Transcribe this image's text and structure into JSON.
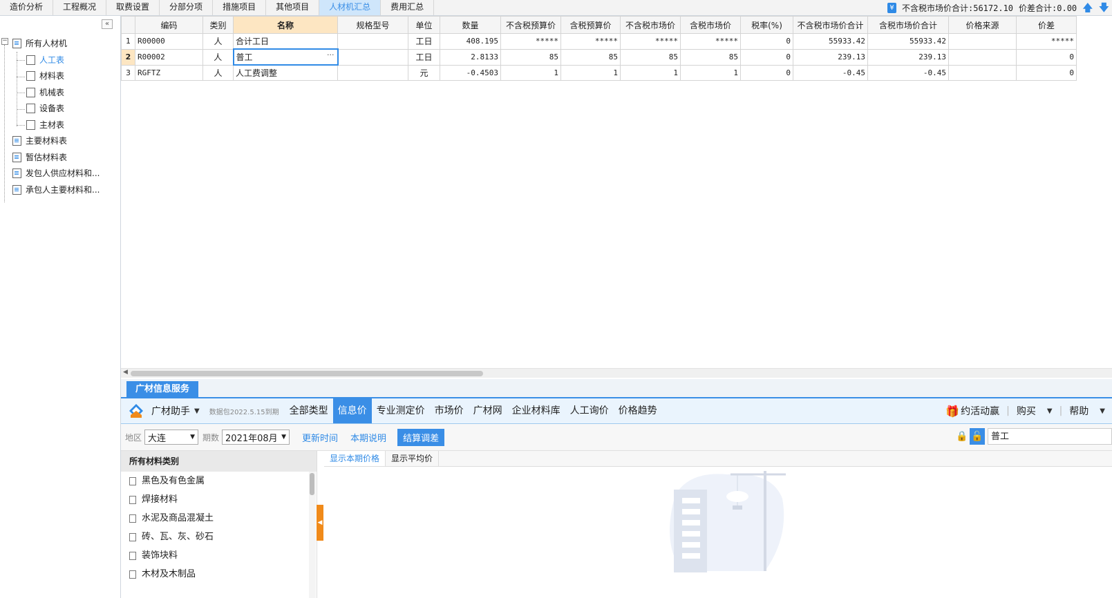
{
  "tabs": [
    {
      "label": "造价分析",
      "active": false
    },
    {
      "label": "工程概况",
      "active": false
    },
    {
      "label": "取费设置",
      "active": false
    },
    {
      "label": "分部分项",
      "active": false
    },
    {
      "label": "措施项目",
      "active": false
    },
    {
      "label": "其他项目",
      "active": false
    },
    {
      "label": "人材机汇总",
      "active": true
    },
    {
      "label": "费用汇总",
      "active": false
    }
  ],
  "summary": {
    "market_total": "不含税市场价合计:56172.10",
    "diff_total": "价差合计:0.00"
  },
  "tree": {
    "root": "所有人材机",
    "children": [
      "人工表",
      "材料表",
      "机械表",
      "设备表",
      "主材表"
    ],
    "selected": "人工表",
    "others": [
      "主要材料表",
      "暂估材料表",
      "发包人供应材料和...",
      "承包人主要材料和..."
    ]
  },
  "grid": {
    "columns": [
      "编码",
      "类别",
      "名称",
      "规格型号",
      "单位",
      "数量",
      "不含税预算价",
      "含税预算价",
      "不含税市场价",
      "含税市场价",
      "税率(%)",
      "不含税市场价合计",
      "含税市场价合计",
      "价格来源",
      "价差"
    ],
    "rows": [
      {
        "no": "1",
        "code": "R00000",
        "type": "人",
        "name": "合计工日",
        "spec": "",
        "unit": "工日",
        "qty": "408.195",
        "budget_ex": "*****",
        "budget_in": "*****",
        "market_ex": "*****",
        "market_in": "*****",
        "tax": "0",
        "total_ex": "55933.42",
        "total_in": "55933.42",
        "source": "",
        "diff": "*****"
      },
      {
        "no": "2",
        "code": "R00002",
        "type": "人",
        "name": "普工",
        "spec": "",
        "unit": "工日",
        "qty": "2.8133",
        "budget_ex": "85",
        "budget_in": "85",
        "market_ex": "85",
        "market_in": "85",
        "tax": "0",
        "total_ex": "239.13",
        "total_in": "239.13",
        "source": "",
        "diff": "0"
      },
      {
        "no": "3",
        "code": "RGFTZ",
        "type": "人",
        "name": "人工费调整",
        "spec": "",
        "unit": "元",
        "qty": "-0.4503",
        "budget_ex": "1",
        "budget_in": "1",
        "market_ex": "1",
        "market_in": "1",
        "tax": "0",
        "total_ex": "-0.45",
        "total_in": "-0.45",
        "source": "",
        "diff": "0"
      }
    ]
  },
  "gc": {
    "panel_tab": "广材信息服务",
    "brand": "广材助手",
    "package": "数据包2022.5.15到期",
    "nav": [
      "全部类型",
      "信息价",
      "专业测定价",
      "市场价",
      "广材网",
      "企业材料库",
      "人工询价",
      "价格趋势"
    ],
    "nav_active": "信息价",
    "right": {
      "promo": "约活动赢",
      "buy": "购买",
      "help": "帮助"
    },
    "filter": {
      "region_label": "地区",
      "region": "大连",
      "period_label": "期数",
      "period": "2021年08月",
      "update_btn": "更新时间",
      "notice_btn": "本期说明",
      "settle_btn": "结算调差"
    },
    "search_value": "普工",
    "categories_title": "所有材料类别",
    "categories": [
      "黑色及有色金属",
      "焊接材料",
      "水泥及商品混凝土",
      "砖、瓦、灰、砂石",
      "装饰块料",
      "木材及木制品"
    ],
    "subtabs": [
      "显示本期价格",
      "显示平均价"
    ]
  },
  "colors": {
    "accent": "#3a8ee6",
    "highlight": "#fde6c2",
    "orange": "#f08a1a"
  }
}
